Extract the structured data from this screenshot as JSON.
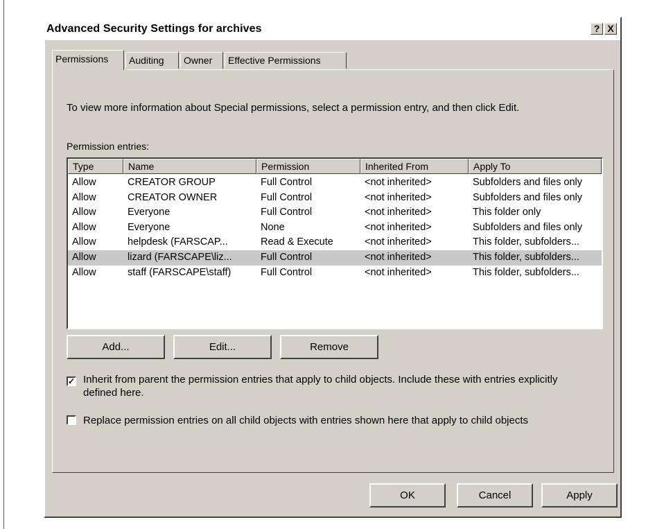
{
  "window": {
    "title": "Advanced Security Settings for archives",
    "help_label": "?",
    "close_label": "X"
  },
  "tabs": [
    {
      "label": "Permissions",
      "active": true
    },
    {
      "label": "Auditing",
      "active": false
    },
    {
      "label": "Owner",
      "active": false
    },
    {
      "label": "Effective Permissions",
      "active": false
    }
  ],
  "permissions": {
    "info_text": "To view more information about Special permissions, select a permission entry, and then click Edit.",
    "list_label": "Permission entries:",
    "columns": [
      "Type",
      "Name",
      "Permission",
      "Inherited From",
      "Apply To"
    ],
    "rows": [
      {
        "type": "Allow",
        "name": "CREATOR GROUP",
        "permission": "Full Control",
        "inherited": "<not inherited>",
        "apply_to": "Subfolders and files only",
        "selected": false
      },
      {
        "type": "Allow",
        "name": "CREATOR OWNER",
        "permission": "Full Control",
        "inherited": "<not inherited>",
        "apply_to": "Subfolders and files only",
        "selected": false
      },
      {
        "type": "Allow",
        "name": "Everyone",
        "permission": "Full Control",
        "inherited": "<not inherited>",
        "apply_to": "This folder only",
        "selected": false
      },
      {
        "type": "Allow",
        "name": "Everyone",
        "permission": "None",
        "inherited": "<not inherited>",
        "apply_to": "Subfolders and files only",
        "selected": false
      },
      {
        "type": "Allow",
        "name": "helpdesk (FARSCAP...",
        "permission": "Read & Execute",
        "inherited": "<not inherited>",
        "apply_to": "This folder, subfolders...",
        "selected": false
      },
      {
        "type": "Allow",
        "name": "lizard (FARSCAPE\\liz...",
        "permission": "Full Control",
        "inherited": "<not inherited>",
        "apply_to": "This folder, subfolders...",
        "selected": true
      },
      {
        "type": "Allow",
        "name": "staff (FARSCAPE\\staff)",
        "permission": "Full Control",
        "inherited": "<not inherited>",
        "apply_to": "This folder, subfolders...",
        "selected": false
      }
    ],
    "buttons": {
      "add": "Add...",
      "edit": "Edit...",
      "remove": "Remove"
    },
    "inherit_checkbox": {
      "checked": true,
      "line1": "Inherit from parent the permission entries that apply to child objects. Include these with entries explicitly",
      "line2": "defined here."
    },
    "replace_checkbox": {
      "checked": false,
      "label": "Replace permission entries on all child objects with entries shown here that apply to child objects"
    }
  },
  "footer": {
    "ok": "OK",
    "cancel": "Cancel",
    "apply": "Apply"
  }
}
